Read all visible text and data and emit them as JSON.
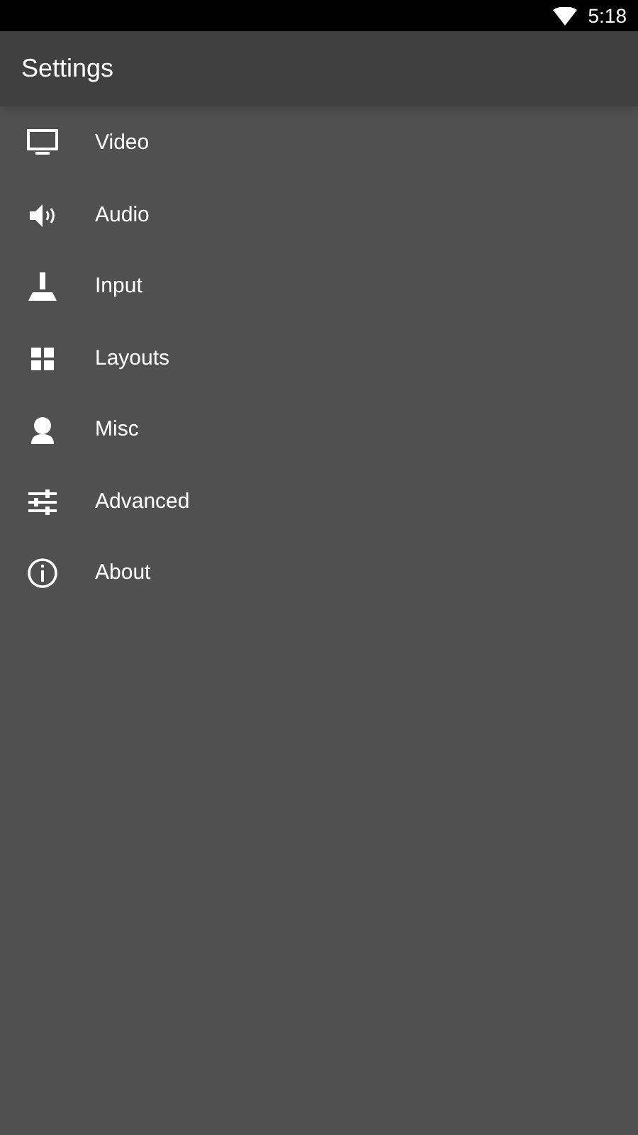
{
  "status_bar": {
    "time": "5:18"
  },
  "app_bar": {
    "title": "Settings"
  },
  "items": [
    {
      "label": "Video",
      "kind": "video"
    },
    {
      "label": "Audio",
      "kind": "audio"
    },
    {
      "label": "Input",
      "kind": "input"
    },
    {
      "label": "Layouts",
      "kind": "layouts"
    },
    {
      "label": "Misc",
      "kind": "misc"
    },
    {
      "label": "Advanced",
      "kind": "advanced"
    },
    {
      "label": "About",
      "kind": "about"
    }
  ]
}
